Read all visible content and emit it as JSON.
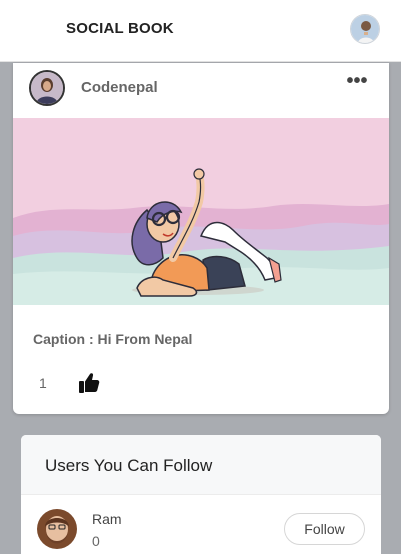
{
  "header": {
    "brand": "SOCIAL BOOK",
    "profile_icon": "user-avatar-icon"
  },
  "post": {
    "author": "Codenepal",
    "menu_icon": "more-horizontal-icon",
    "menu_label": "•••",
    "caption": "Caption : Hi From Nepal",
    "likes": "1",
    "like_icon": "thumbs-up-icon"
  },
  "suggestions": {
    "title": "Users You Can Follow",
    "users": [
      {
        "name": "Ram",
        "count": "0",
        "button_label": "Follow"
      }
    ]
  },
  "colors": {
    "page_background": "#a9acb1",
    "card_background": "#ffffff",
    "illustration_sky": "#f2cfe0",
    "illustration_hills": "#c9e3de"
  }
}
